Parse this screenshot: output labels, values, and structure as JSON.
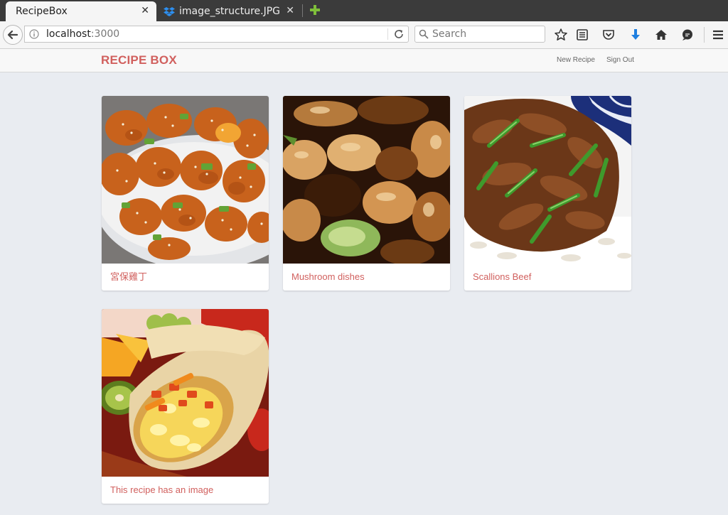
{
  "browser": {
    "tabs": [
      {
        "label": "RecipeBox",
        "active": true
      },
      {
        "label": "image_structure.JPG",
        "active": false
      }
    ],
    "url_host": "localhost",
    "url_port": ":3000",
    "search_placeholder": "Search",
    "toolbar_icons": [
      "bookmark-star-icon",
      "reader-view-icon",
      "pocket-icon",
      "download-icon",
      "home-icon",
      "chat-icon",
      "hamburger-menu-icon"
    ]
  },
  "app": {
    "brand": "RECIPE BOX",
    "nav": {
      "new_recipe": "New Recipe",
      "sign_out": "Sign Out"
    },
    "accent_color": "#d1605e",
    "recipes": [
      {
        "title": "宮保雞丁",
        "image": "kung pao chicken with sesame and scallions"
      },
      {
        "title": "Mushroom dishes",
        "image": "glazed stir-fried mushrooms"
      },
      {
        "title": "Scallions Beef",
        "image": "beef with scallions over rice"
      },
      {
        "title": "This recipe has an image",
        "image": "breakfast burrito with fruit"
      }
    ]
  }
}
